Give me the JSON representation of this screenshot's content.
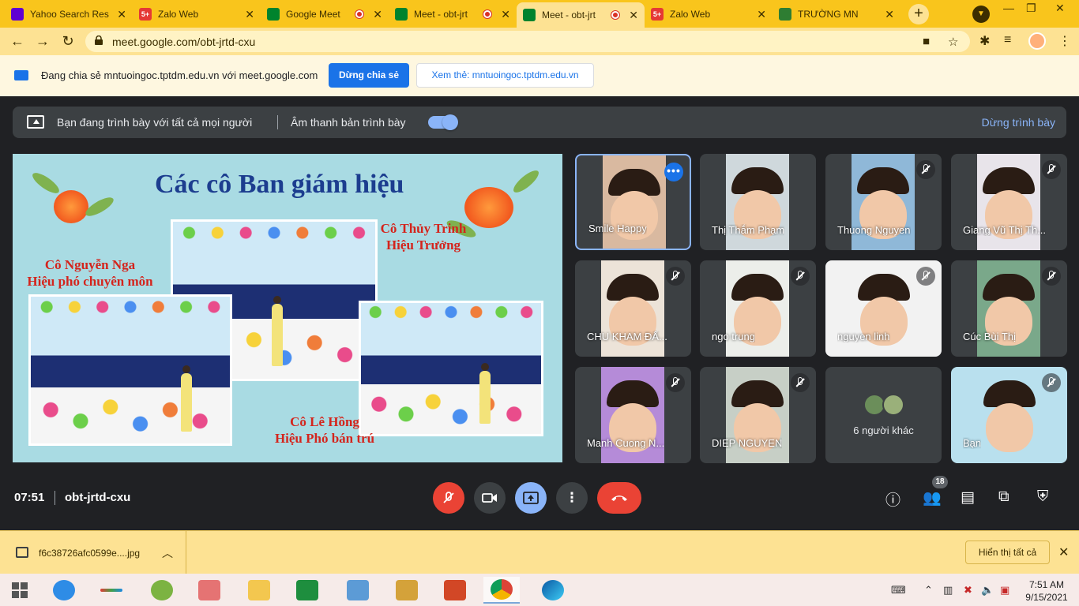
{
  "browser": {
    "tabs": [
      {
        "title": "Yahoo Search Res",
        "favicon": "yahoo-icon",
        "color": "#6001d2",
        "recording": false,
        "active": false
      },
      {
        "title": "Zalo Web",
        "favicon": "zalo-icon",
        "color": "#e53935",
        "badge": "5+",
        "recording": false,
        "active": false
      },
      {
        "title": "Google Meet",
        "favicon": "meet-icon",
        "color": "#00832d",
        "recording": true,
        "active": false
      },
      {
        "title": "Meet - obt-jrt",
        "favicon": "meet-icon",
        "color": "#00832d",
        "recording": true,
        "active": false
      },
      {
        "title": "Meet - obt-jrt",
        "favicon": "meet-icon",
        "color": "#00832d",
        "recording": true,
        "active": true
      },
      {
        "title": "Zalo Web",
        "favicon": "zalo-icon",
        "color": "#e53935",
        "badge": "5+",
        "recording": false,
        "active": false
      },
      {
        "title": "TRƯỜNG MN",
        "favicon": "school-icon",
        "color": "#2e7d32",
        "recording": false,
        "active": false
      }
    ],
    "url": "meet.google.com/obt-jrtd-cxu"
  },
  "share_bar": {
    "message": "Đang chia sẻ mntuoingoc.tptdm.edu.vn với meet.google.com",
    "stop_label": "Dừng chia sẻ",
    "view_label": "Xem thẻ: mntuoingoc.tptdm.edu.vn"
  },
  "meet": {
    "banner": {
      "presenting": "Bạn đang trình bày với tất cả mọi người",
      "audio": "Âm thanh bản trình bày",
      "audio_on": true,
      "stop": "Dừng trình bày"
    },
    "slide": {
      "title": "Các cô Ban giám hiệu",
      "captions": [
        {
          "line1": "Cô Thủy Trinh",
          "line2": "Hiệu Trưởng"
        },
        {
          "line1": "Cô Nguyễn Nga",
          "line2": "Hiệu phó chuyên môn"
        },
        {
          "line1": "Cô Lê Hồng",
          "line2": "Hiệu Phó bán trú"
        }
      ]
    },
    "participants": [
      {
        "name": "Smile Happy",
        "speaking": true,
        "muted": false,
        "bg": "#d9b9a0"
      },
      {
        "name": "Thị Thắm Phạm",
        "speaking": false,
        "muted": false,
        "bg": "#cfd8dc"
      },
      {
        "name": "Thuong Nguyen",
        "speaking": false,
        "muted": true,
        "bg": "#8fb8d8"
      },
      {
        "name": "Giang Vũ Thị Th...",
        "speaking": false,
        "muted": true,
        "bg": "#e8e4ea"
      },
      {
        "name": "CHU KHAM ĐẤ...",
        "speaking": false,
        "muted": true,
        "bg": "#ece3d8"
      },
      {
        "name": "ngo trung",
        "speaking": false,
        "muted": true,
        "bg": "#eceeea"
      },
      {
        "name": "nguyen linh",
        "speaking": false,
        "muted": true,
        "bg": "#f2f2f2"
      },
      {
        "name": "Cúc Bùi Thị",
        "speaking": false,
        "muted": true,
        "bg": "#7aa88a"
      },
      {
        "name": "Manh Cuong N...",
        "speaking": false,
        "muted": true,
        "bg": "#b58bd8"
      },
      {
        "name": "DIEP NGUYEN",
        "speaking": false,
        "muted": true,
        "bg": "#c7cfc6"
      },
      {
        "name": "Bạn",
        "speaking": false,
        "muted": true,
        "bg": "#b9e0ee"
      }
    ],
    "others_label": "6 người khác",
    "time": "07:51",
    "meeting_code": "obt-jrtd-cxu",
    "people_count": "18"
  },
  "downloads": {
    "file": "f6c38726afc0599e....jpg",
    "show_all": "Hiển thị tất cả"
  },
  "taskbar": {
    "time": "7:51 AM",
    "date": "9/15/2021"
  }
}
